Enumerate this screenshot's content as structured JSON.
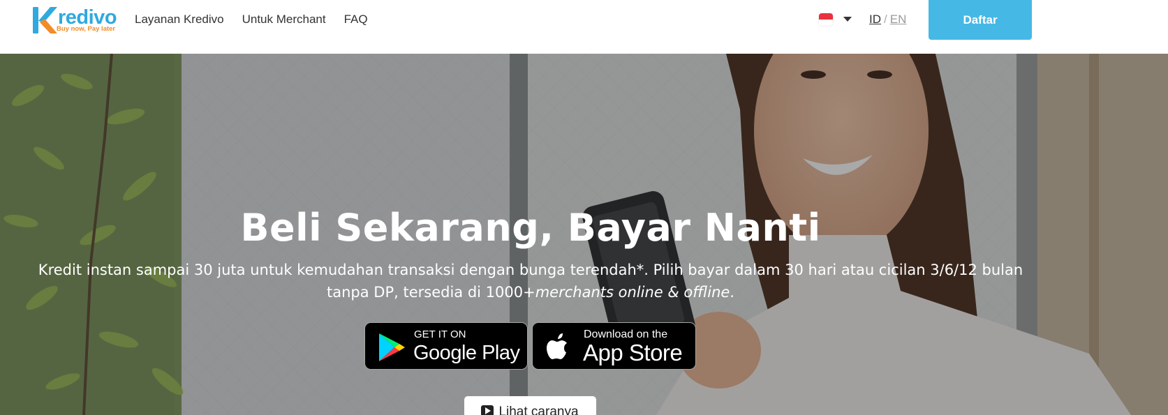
{
  "header": {
    "logo": {
      "brand": "Kredivo",
      "tagline": "Buy now, Pay later"
    },
    "nav": [
      {
        "label": "Layanan Kredivo"
      },
      {
        "label": "Untuk Merchant"
      },
      {
        "label": "FAQ"
      }
    ],
    "language": {
      "flag_icon": "indonesia-flag-icon",
      "current": "ID",
      "separator": "/",
      "other": "EN"
    },
    "signup_label": "Daftar"
  },
  "hero": {
    "title": "Beli Sekarang, Bayar Nanti",
    "subtitle_main": "Kredit instan sampai 30 juta untuk kemudahan transaksi dengan bunga terendah*. Pilih bayar dalam 30 hari atau cicilan 3/6/12 bulan tanpa DP, tersedia di 1000+",
    "subtitle_italic": "merchants online & offline",
    "subtitle_end": ".",
    "google_play": {
      "small": "GET IT ON",
      "big": "Google Play",
      "icon": "google-play-icon"
    },
    "app_store": {
      "small": "Download on the",
      "big": "App Store",
      "icon": "apple-icon"
    },
    "video_button": {
      "label": "Lihat caranya",
      "icon": "play-video-icon"
    }
  },
  "colors": {
    "brand_blue": "#45b8e6",
    "logo_orange": "#f28c28",
    "nav_text": "#333333"
  }
}
